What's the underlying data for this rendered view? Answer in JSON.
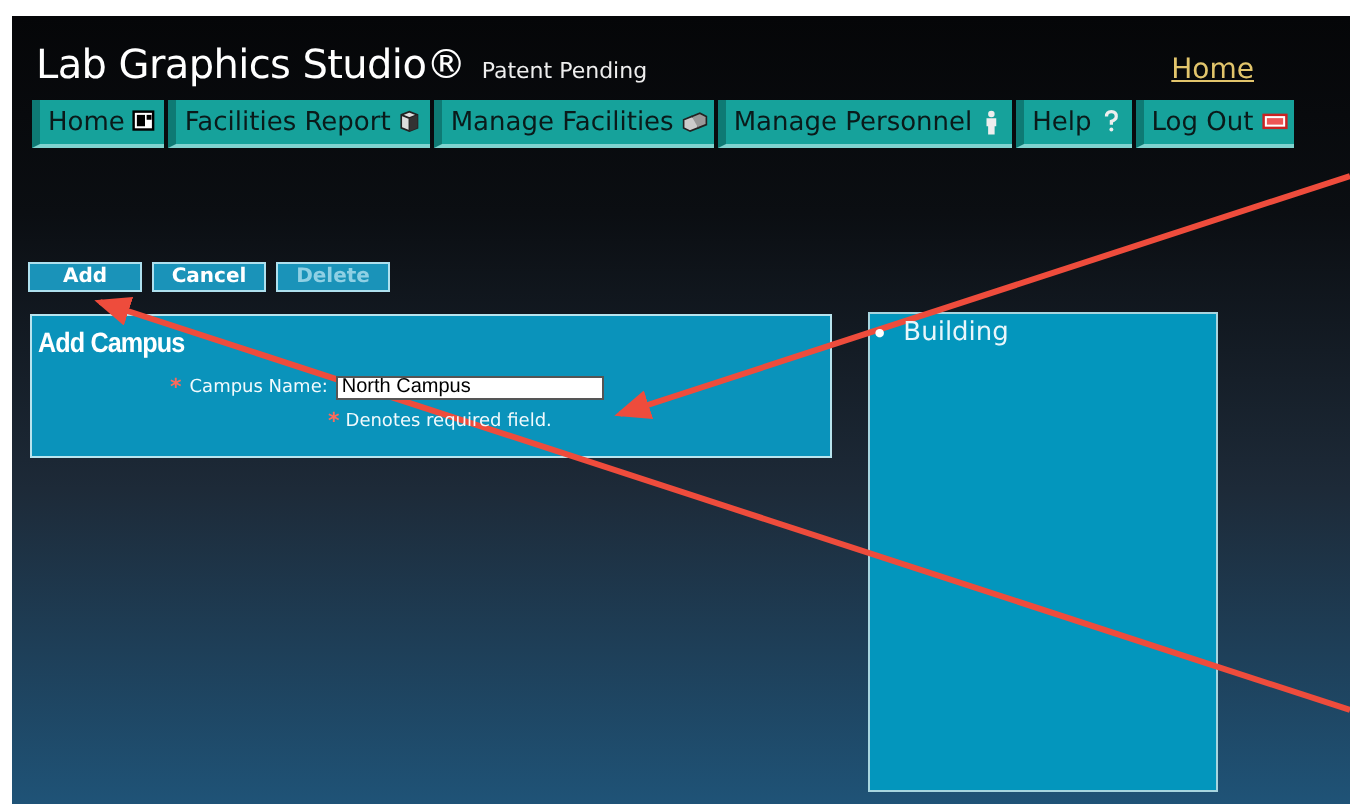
{
  "header": {
    "title": "Lab Graphics Studio®",
    "subtitle": "Patent Pending",
    "home_link": "Home"
  },
  "tabs": [
    {
      "label": "Home",
      "kind": "window"
    },
    {
      "label": "Facilities Report",
      "kind": "cube"
    },
    {
      "label": "Manage Facilities",
      "kind": "boxes"
    },
    {
      "label": "Manage Personnel",
      "kind": "person"
    },
    {
      "label": "Help",
      "kind": "question"
    },
    {
      "label": "Log Out",
      "kind": "exit"
    }
  ],
  "buttons": [
    {
      "label": "Add",
      "disabled": false
    },
    {
      "label": "Cancel",
      "disabled": false
    },
    {
      "label": "Delete",
      "disabled": true
    }
  ],
  "form": {
    "title": "Add Campus",
    "fields": [
      {
        "label": "Campus Name:",
        "required_mark": "*",
        "value": "North Campus"
      }
    ],
    "note_mark": "*",
    "required_note": "Denotes required field."
  },
  "tree": {
    "items": [
      {
        "marker": "•",
        "label": "Building"
      }
    ]
  }
}
